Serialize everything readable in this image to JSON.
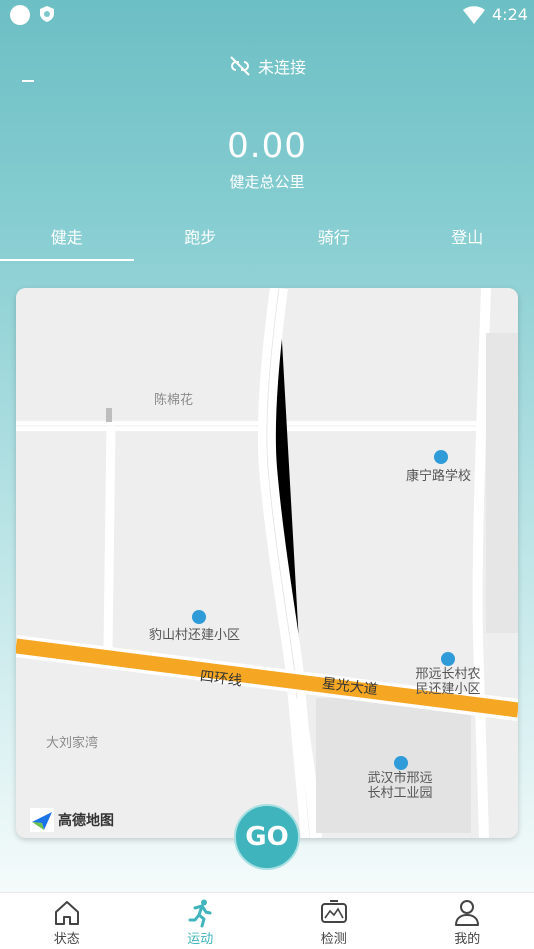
{
  "status_bar": {
    "time": "4:24"
  },
  "header": {
    "connection_status": "未连接",
    "distance_value": "0.00",
    "distance_label": "健走总公里"
  },
  "tabs": [
    {
      "label": "健走",
      "active": true
    },
    {
      "label": "跑步",
      "active": false
    },
    {
      "label": "骑行",
      "active": false
    },
    {
      "label": "登山",
      "active": false
    }
  ],
  "map": {
    "place_labels": {
      "chen_mianhua": "陈棉花",
      "kangning_school": "康宁路学校",
      "baoshan_village": "豹山村还建小区",
      "xingyuan_village": "邢远长村农民还建小区",
      "da_liu_jia_wan": "大刘家湾",
      "industrial_park": "武汉市邢远长村工业园"
    },
    "road_labels": {
      "ring_road": "四环线",
      "xingguang_avenue": "星光大道"
    },
    "provider_logo": "高德地图"
  },
  "go_button": {
    "label": "GO"
  },
  "bottom_nav": [
    {
      "label": "状态",
      "icon": "home-icon",
      "active": false
    },
    {
      "label": "运动",
      "icon": "running-icon",
      "active": true
    },
    {
      "label": "检测",
      "icon": "monitor-icon",
      "active": false
    },
    {
      "label": "我的",
      "icon": "profile-icon",
      "active": false
    }
  ],
  "colors": {
    "accent": "#3fb4bc",
    "ring_road": "#f5a623"
  }
}
